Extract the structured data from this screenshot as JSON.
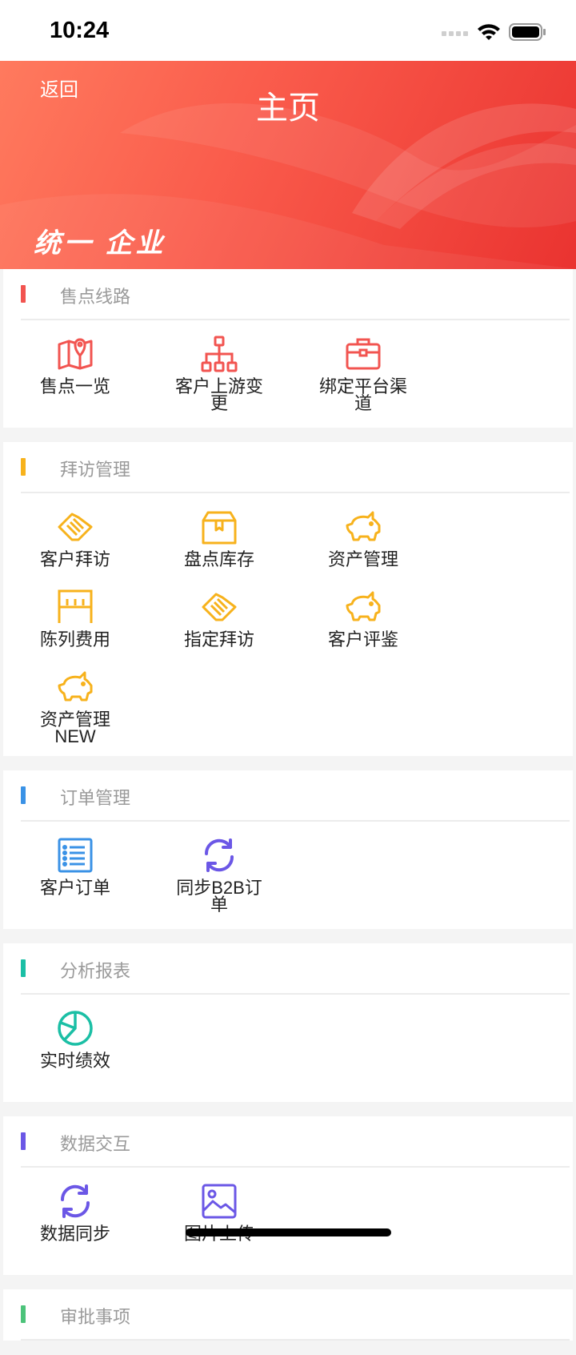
{
  "status_bar": {
    "time": "10:24"
  },
  "header": {
    "back_label": "返回",
    "title": "主页",
    "brand": "统一 企业"
  },
  "colors": {
    "red": "#f25450",
    "orange": "#f7b21c",
    "blue": "#3a92e6",
    "teal": "#1bbfa5",
    "purple": "#6b57e6",
    "green": "#4cc37a"
  },
  "sections": [
    {
      "title": "售点线路",
      "items": [
        {
          "label": "售点一览",
          "icon": "map-pin-icon"
        },
        {
          "label": "客户上游变更",
          "icon": "org-tree-icon"
        },
        {
          "label": "绑定平台渠道",
          "icon": "briefcase-icon"
        }
      ]
    },
    {
      "title": "拜访管理",
      "items": [
        {
          "label": "客户拜访",
          "icon": "handshake-icon"
        },
        {
          "label": "盘点库存",
          "icon": "box-icon"
        },
        {
          "label": "资产管理",
          "icon": "piggy-bank-icon"
        },
        {
          "label": "陈列费用",
          "icon": "shelf-icon"
        },
        {
          "label": "指定拜访",
          "icon": "handshake-icon"
        },
        {
          "label": "客户评鉴",
          "icon": "piggy-bank-icon"
        },
        {
          "label": "资产管理NEW",
          "icon": "piggy-bank-icon"
        }
      ]
    },
    {
      "title": "订单管理",
      "items": [
        {
          "label": "客户订单",
          "icon": "list-icon"
        },
        {
          "label": "同步B2B订单",
          "icon": "sync-icon"
        }
      ]
    },
    {
      "title": "分析报表",
      "items": [
        {
          "label": "实时绩效",
          "icon": "pie-chart-icon"
        }
      ]
    },
    {
      "title": "数据交互",
      "items": [
        {
          "label": "数据同步",
          "icon": "sync-icon"
        },
        {
          "label": "图片上传",
          "icon": "image-icon"
        }
      ]
    },
    {
      "title": "审批事项",
      "items": []
    }
  ]
}
